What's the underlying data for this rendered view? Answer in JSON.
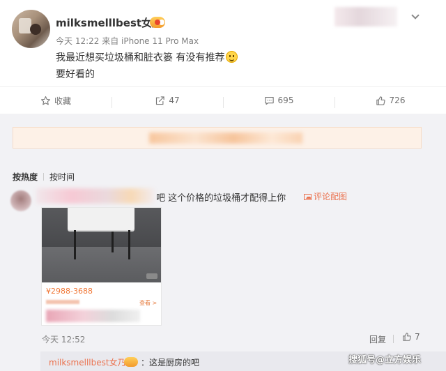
{
  "post": {
    "username": "milksmelllbest女乃",
    "time": "今天 12:22",
    "source": "来自 iPhone 11 Pro Max",
    "content_line1": "我最近想买垃圾桶和脏衣篓 有没有推荐",
    "content_line2": "要好看的"
  },
  "actions": {
    "favorite_label": "收藏",
    "repost_count": "47",
    "comment_count": "695",
    "like_count": "726"
  },
  "comments": {
    "sort_hot": "按热度",
    "sort_time": "按时间",
    "item": {
      "text": "吧 这个价格的垃圾桶才配得上你",
      "pic_link": "评论配图",
      "price": "¥2988-3688",
      "detail": "查看 >",
      "time": "今天 12:52",
      "reply_label": "回复",
      "like_count": "7"
    },
    "sub_reply": {
      "name": "milksmelllbest女乃",
      "text": "：这是厨房的吧"
    }
  },
  "watermark": "搜狐号@立方娱乐",
  "colors": {
    "accent": "#eb7350",
    "background": "#f2f2f5",
    "price": "#f07838"
  }
}
